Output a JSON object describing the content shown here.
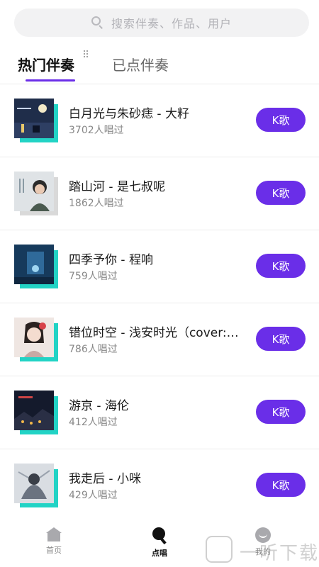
{
  "search": {
    "placeholder": "搜索伴奏、作品、用户"
  },
  "tabs": {
    "hot": "热门伴奏",
    "done": "已点伴奏"
  },
  "songs": [
    {
      "title": "白月光与朱砂痣 - 大籽",
      "count": "3702人唱过",
      "button": "K歌"
    },
    {
      "title": "踏山河 - 是七叔呢",
      "count": "1862人唱过",
      "button": "K歌"
    },
    {
      "title": "四季予你 - 程响",
      "count": "759人唱过",
      "button": "K歌"
    },
    {
      "title": "错位时空 - 浅安时光（cover:…",
      "count": "786人唱过",
      "button": "K歌"
    },
    {
      "title": "游京 - 海伦",
      "count": "412人唱过",
      "button": "K歌"
    },
    {
      "title": "我走后 - 小咪",
      "count": "429人唱过",
      "button": "K歌"
    }
  ],
  "nav": {
    "home": "首页",
    "sing": "点唱",
    "me": "我的"
  },
  "watermark": {
    "text": "一听下载"
  },
  "colors": {
    "accent": "#6a2ee8",
    "cover_shadow": "#22d3c5"
  },
  "icons": {
    "search": "search-icon",
    "home": "home-icon",
    "sing": "microphone-icon",
    "me": "smile-icon"
  }
}
